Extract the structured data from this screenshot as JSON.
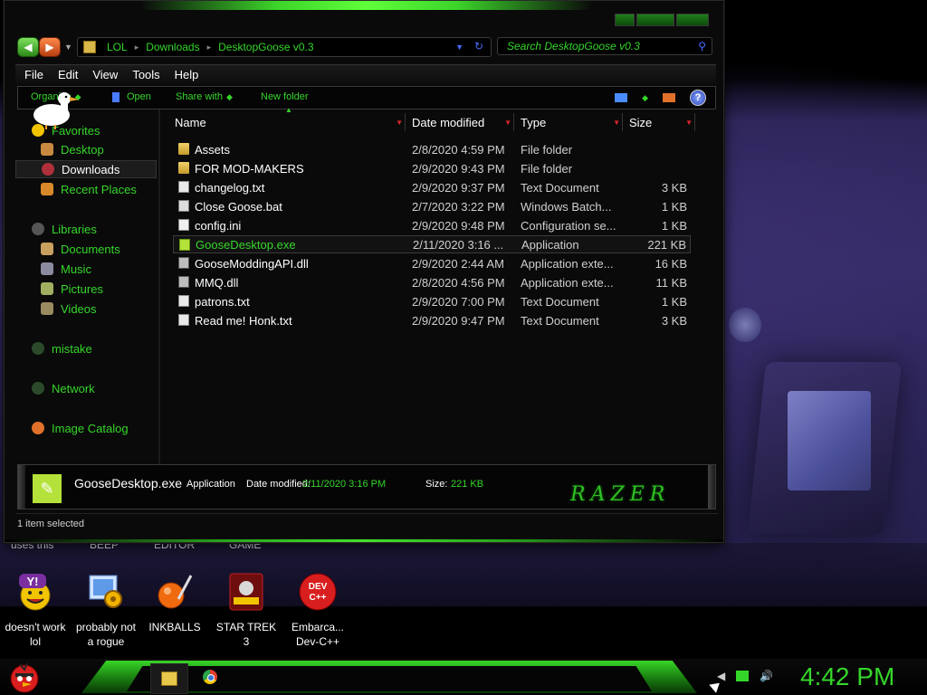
{
  "address": {
    "crumbs": [
      "LOL",
      "Downloads",
      "DesktopGoose v0.3"
    ]
  },
  "search": {
    "placeholder": "Search DesktopGoose v0.3"
  },
  "menu": [
    "File",
    "Edit",
    "View",
    "Tools",
    "Help"
  ],
  "toolbar": {
    "organize": "Organize",
    "open": "Open",
    "share": "Share with",
    "new_folder": "New folder"
  },
  "nav": {
    "favorites": "Favorites",
    "desktop": "Desktop",
    "downloads": "Downloads",
    "recent": "Recent Places",
    "libraries": "Libraries",
    "documents": "Documents",
    "music": "Music",
    "pictures": "Pictures",
    "videos": "Videos",
    "mistake": "mistake",
    "network": "Network",
    "image_catalog": "Image Catalog"
  },
  "columns": {
    "name": "Name",
    "date": "Date modified",
    "type": "Type",
    "size": "Size"
  },
  "files": [
    {
      "name": "Assets",
      "date": "2/8/2020 4:59 PM",
      "type": "File folder",
      "size": "",
      "icon": "folder-icon"
    },
    {
      "name": "FOR MOD-MAKERS",
      "date": "2/9/2020 9:43 PM",
      "type": "File folder",
      "size": "",
      "icon": "folder-icon"
    },
    {
      "name": "changelog.txt",
      "date": "2/9/2020 9:37 PM",
      "type": "Text Document",
      "size": "3 KB",
      "icon": "text-file-icon"
    },
    {
      "name": "Close Goose.bat",
      "date": "2/7/2020 3:22 PM",
      "type": "Windows Batch...",
      "size": "1 KB",
      "icon": "batch-file-icon"
    },
    {
      "name": "config.ini",
      "date": "2/9/2020 9:48 PM",
      "type": "Configuration se...",
      "size": "1 KB",
      "icon": "config-file-icon"
    },
    {
      "name": "GooseDesktop.exe",
      "date": "2/11/2020 3:16 ...",
      "type": "Application",
      "size": "221 KB",
      "icon": "goose-app-icon"
    },
    {
      "name": "GooseModdingAPI.dll",
      "date": "2/9/2020 2:44 AM",
      "type": "Application exte...",
      "size": "16 KB",
      "icon": "dll-file-icon"
    },
    {
      "name": "MMQ.dll",
      "date": "2/8/2020 4:56 PM",
      "type": "Application exte...",
      "size": "11 KB",
      "icon": "dll-file-icon"
    },
    {
      "name": "patrons.txt",
      "date": "2/9/2020 7:00 PM",
      "type": "Text Document",
      "size": "1 KB",
      "icon": "text-file-icon"
    },
    {
      "name": "Read me! Honk.txt",
      "date": "2/9/2020 9:47 PM",
      "type": "Text Document",
      "size": "3 KB",
      "icon": "text-file-icon"
    }
  ],
  "details": {
    "filename": "GooseDesktop.exe",
    "type": "Application",
    "modified_label": "Date modified:",
    "modified": "2/11/2020 3:16 PM",
    "size_label": "Size:",
    "size": "221 KB",
    "brand": "RAZER"
  },
  "status": "1 item selected",
  "desktop": {
    "top_labels": [
      "uses this",
      "BEEP",
      "EDITOR",
      "GAME"
    ],
    "icons": [
      {
        "label1": "doesn't work",
        "label2": "lol"
      },
      {
        "label1": "probably not",
        "label2": "a rogue"
      },
      {
        "label1": "INKBALLS",
        "label2": ""
      },
      {
        "label1": "STAR TREK",
        "label2": "3"
      },
      {
        "label1": "Embarca...",
        "label2": "Dev-C++"
      }
    ]
  },
  "dev_icon_text": {
    "line1": "DEV",
    "line2": "C++"
  },
  "clock": "4:42 PM",
  "colors": {
    "accent_green": "#35d62a",
    "selection": "#121212",
    "sort_arrow": "#e0262b"
  }
}
